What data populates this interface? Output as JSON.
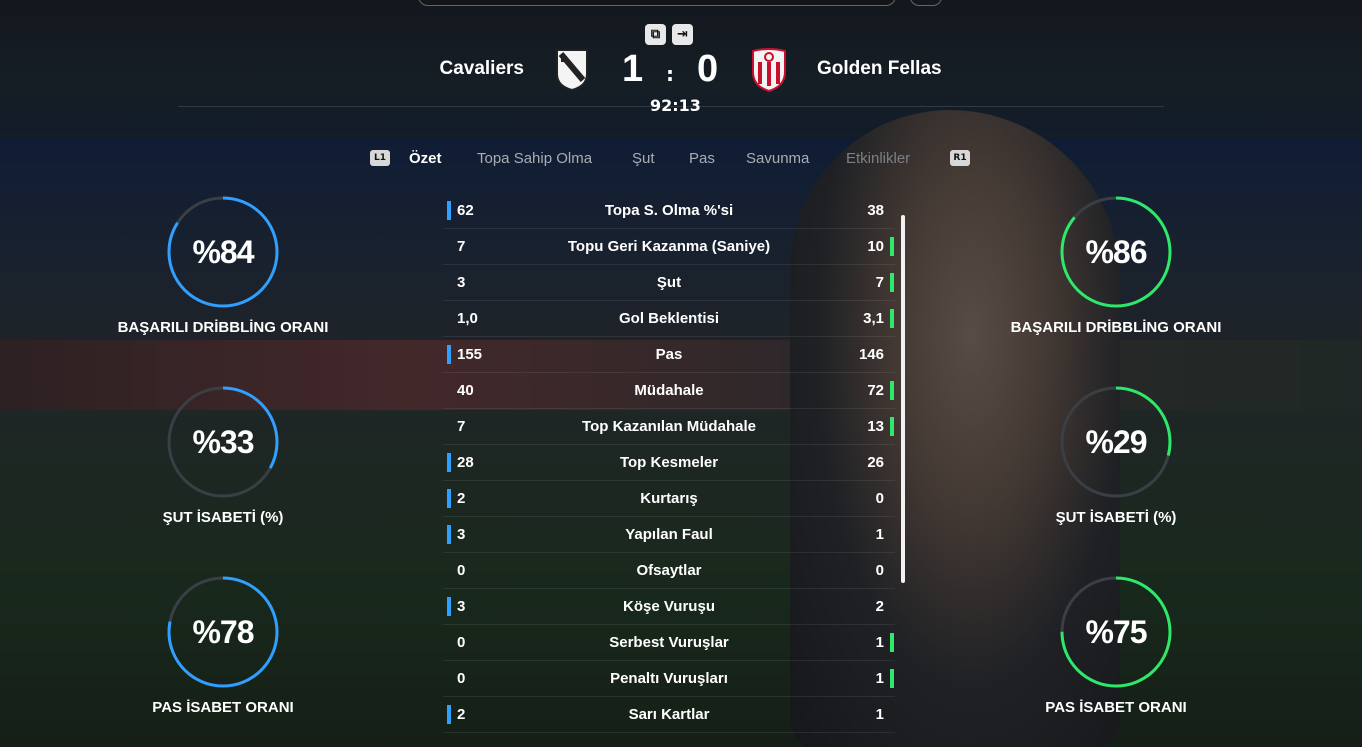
{
  "header": {
    "home_team": "Cavaliers",
    "away_team": "Golden Fellas",
    "home_score": "1",
    "away_score": "0",
    "separator": ":",
    "clock": "92:13"
  },
  "tabs": {
    "left_button": "L1",
    "right_button": "R1",
    "items": [
      "Özet",
      "Topa Sahip Olma",
      "Şut",
      "Pas",
      "Savunma",
      "Etkinlikler"
    ]
  },
  "gauges": {
    "home": [
      {
        "value": "%84",
        "label": "BAŞARILI DRİBBLİNG ORANI",
        "fraction": 0.84
      },
      {
        "value": "%33",
        "label": "ŞUT İSABETİ (%)",
        "fraction": 0.33
      },
      {
        "value": "%78",
        "label": "PAS İSABET ORANI",
        "fraction": 0.78
      }
    ],
    "away": [
      {
        "value": "%86",
        "label": "BAŞARILI DRİBBLİNG ORANI",
        "fraction": 0.86
      },
      {
        "value": "%29",
        "label": "ŞUT İSABETİ (%)",
        "fraction": 0.29
      },
      {
        "value": "%75",
        "label": "PAS İSABET ORANI",
        "fraction": 0.75
      }
    ]
  },
  "stats": [
    {
      "name": "Topa S. Olma %'si",
      "home": "62",
      "away": "38",
      "leader": "home"
    },
    {
      "name": "Topu Geri Kazanma (Saniye)",
      "home": "7",
      "away": "10",
      "leader": "away"
    },
    {
      "name": "Şut",
      "home": "3",
      "away": "7",
      "leader": "away"
    },
    {
      "name": "Gol Beklentisi",
      "home": "1,0",
      "away": "3,1",
      "leader": "away"
    },
    {
      "name": "Pas",
      "home": "155",
      "away": "146",
      "leader": "home"
    },
    {
      "name": "Müdahale",
      "home": "40",
      "away": "72",
      "leader": "away"
    },
    {
      "name": "Top Kazanılan Müdahale",
      "home": "7",
      "away": "13",
      "leader": "away"
    },
    {
      "name": "Top Kesmeler",
      "home": "28",
      "away": "26",
      "leader": "home"
    },
    {
      "name": "Kurtarış",
      "home": "2",
      "away": "0",
      "leader": "home"
    },
    {
      "name": "Yapılan Faul",
      "home": "3",
      "away": "1",
      "leader": "home"
    },
    {
      "name": "Ofsaytlar",
      "home": "0",
      "away": "0",
      "leader": "none"
    },
    {
      "name": "Köşe Vuruşu",
      "home": "3",
      "away": "2",
      "leader": "home"
    },
    {
      "name": "Serbest Vuruşlar",
      "home": "0",
      "away": "1",
      "leader": "away"
    },
    {
      "name": "Penaltı Vuruşları",
      "home": "0",
      "away": "1",
      "leader": "away"
    },
    {
      "name": "Sarı Kartlar",
      "home": "2",
      "away": "1",
      "leader": "home"
    }
  ],
  "colors": {
    "home_accent": "#2fa0ff",
    "away_accent": "#2ee86a"
  }
}
